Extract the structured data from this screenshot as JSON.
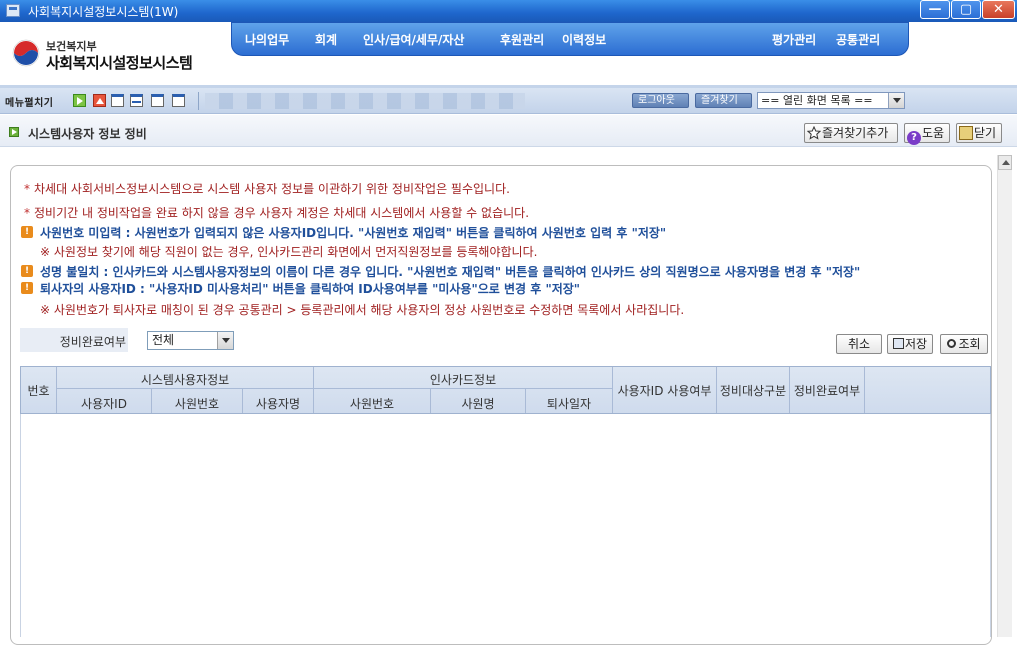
{
  "window": {
    "title": "사회복지시설정보시스템(1W)",
    "min_symbol": "—",
    "max_symbol": "▢",
    "close_symbol": "✕"
  },
  "header": {
    "logo_sub": "보건복지부",
    "logo_main": "사회복지시설정보시스템",
    "menu": [
      "나의업무",
      "회계",
      "인사/급여/세무/자산",
      "후원관리",
      "이력정보",
      "평가관리",
      "공통관리"
    ]
  },
  "toolbar": {
    "label": "메뉴펼치기",
    "logout": "로그아웃",
    "favorites": "즐겨찾기",
    "open_screens": "== 열린 화면 목록 =="
  },
  "page": {
    "title": "시스템사용자 정보 정비",
    "add_favorite": "즐겨찾기추가",
    "help": "도움",
    "close": "닫기"
  },
  "notes": {
    "n1": "차세대 사회서비스정보시스템으로 시스템 사용자 정보를 이관하기 위한 정비작업은 필수입니다.",
    "n2": "정비기간 내 정비작업을 완료 하지 않을 경우 사용자 계정은 차세대 시스템에서 사용할 수 없습니다.",
    "w1": "사원번호 미입력 : 사원번호가 입력되지 않은 사용자ID입니다. \"사원번호 재입력\" 버튼을 클릭하여 사원번호 입력 후 \"저장\"",
    "w1_sub": "※ 사원정보 찾기에 해당 직원이 없는 경우, 인사카드관리 화면에서 먼저직원정보를 등록해야합니다.",
    "w2": "성명 불일치 : 인사카드와 시스템사용자정보의 이름이 다른 경우 입니다. \"사원번호 재입력\" 버튼을 클릭하여 인사카드 상의 직원명으로 사용자명을 변경 후 \"저장\"",
    "w3": "퇴사자의 사용자ID : \"사용자ID 미사용처리\" 버튼을 클릭하여 ID사용여부를 \"미사용\"으로 변경 후 \"저장\"",
    "w3_sub": "※ 사원번호가 퇴사자로 매칭이 된 경우 공통관리 > 등록관리에서 해당 사용자의 정상 사원번호로 수정하면 목록에서 사라집니다.",
    "star": "*",
    "warn": "!"
  },
  "filter": {
    "label": "정비완료여부",
    "value": "전체"
  },
  "actions": {
    "cancel": "취소",
    "save": "저장",
    "search": "조회"
  },
  "grid": {
    "no": "번호",
    "group_system": "시스템사용자정보",
    "group_hr": "인사카드정보",
    "user_id": "사용자ID",
    "emp_no": "사원번호",
    "user_name": "사용자명",
    "hr_emp_no": "사원번호",
    "hr_emp_name": "사원명",
    "leave_date": "퇴사일자",
    "id_use": "사용자ID 사용여부",
    "target_type": "정비대상구분",
    "complete": "정비완료여부"
  }
}
